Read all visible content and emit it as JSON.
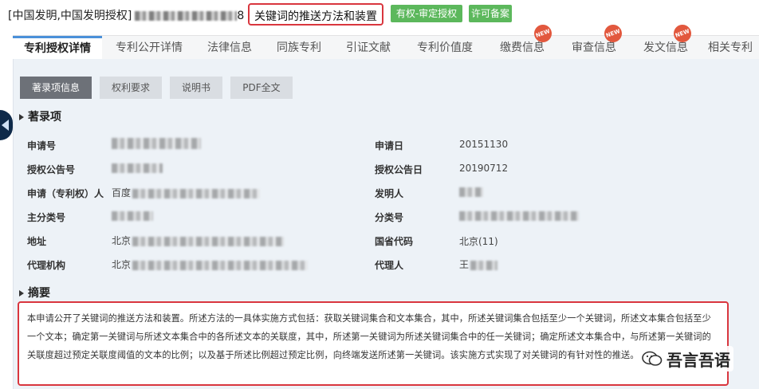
{
  "header": {
    "patent_type": "[中国发明,中国发明授权]",
    "patent_suffix": "8",
    "patent_title": "关键词的推送方法和装置",
    "status_badge": "有权-审定授权",
    "license_badge": "许可备案"
  },
  "tabs": [
    {
      "label": "专利授权详情",
      "active": true,
      "new": false
    },
    {
      "label": "专利公开详情",
      "active": false,
      "new": false
    },
    {
      "label": "法律信息",
      "active": false,
      "new": false
    },
    {
      "label": "同族专利",
      "active": false,
      "new": false
    },
    {
      "label": "引证文献",
      "active": false,
      "new": false
    },
    {
      "label": "专利价值度",
      "active": false,
      "new": false
    },
    {
      "label": "缴费信息",
      "active": false,
      "new": true
    },
    {
      "label": "审查信息",
      "active": false,
      "new": true
    },
    {
      "label": "发文信息",
      "active": false,
      "new": true
    },
    {
      "label": "相关专利",
      "active": false,
      "new": false
    }
  ],
  "new_badge": "NEW",
  "subtabs": [
    "著录项信息",
    "权利要求",
    "说明书",
    "PDF全文"
  ],
  "bibliography": {
    "section_title": "著录项",
    "labels": {
      "app_no": "申请号",
      "app_date": "申请日",
      "grant_pub_no": "授权公告号",
      "grant_pub_date": "授权公告日",
      "applicant": "申请（专利权）人",
      "inventor": "发明人",
      "main_class": "主分类号",
      "class": "分类号",
      "address": "地址",
      "province": "国省代码",
      "agency": "代理机构",
      "agent": "代理人"
    },
    "values": {
      "app_date": "20151130",
      "grant_pub_date": "20190712",
      "applicant_prefix": "百度",
      "address_prefix": "北京",
      "province": "北京(11)",
      "agency_prefix": "北京",
      "agent_prefix": "王"
    }
  },
  "abstract": {
    "section_title": "摘要",
    "text": "本申请公开了关键词的推送方法和装置。所述方法的一具体实施方式包括：获取关键词集合和文本集合，其中，所述关键词集合包括至少一个关键词，所述文本集合包括至少一个文本；确定第一关键词与所述文本集合中的各所述文本的关联度，其中，所述第一关键词为所述关键词集合中的任一关键词；确定所述文本集合中，与所述第一关键词的关联度超过预定关联度阈值的文本的比例；以及基于所述比例超过预定比例，向终端发送所述第一关键词。该实施方式实现了对关键词的有针对性的推送。"
  },
  "watermark": "吾言吾语",
  "colors": {
    "highlight_border": "#d9363e",
    "badge_green": "#5cb85c",
    "active_tab_bar": "#4a90d9",
    "new_badge": "#e2583e",
    "side_arrow": "#0e2a4a"
  }
}
